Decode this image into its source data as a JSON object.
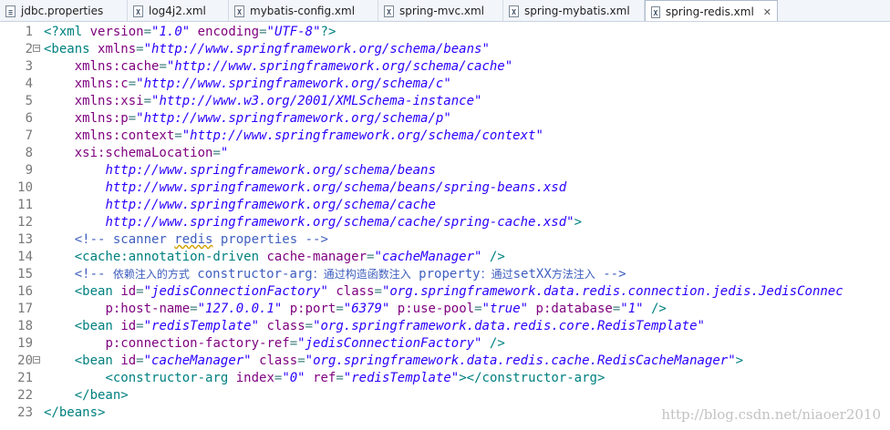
{
  "tabs": [
    {
      "label": "jdbc.properties",
      "icon": "properties-file-icon",
      "active": false
    },
    {
      "label": "log4j2.xml",
      "icon": "xml-file-icon",
      "active": false
    },
    {
      "label": "mybatis-config.xml",
      "icon": "xml-file-icon",
      "active": false
    },
    {
      "label": "spring-mvc.xml",
      "icon": "xml-file-icon",
      "active": false
    },
    {
      "label": "spring-mybatis.xml",
      "icon": "xml-file-icon",
      "active": false
    },
    {
      "label": "spring-redis.xml",
      "icon": "xml-file-icon",
      "active": true,
      "close": "✕"
    }
  ],
  "code_lines": [
    {
      "n": "1",
      "text": "<?xml version=\"1.0\" encoding=\"UTF-8\"?>"
    },
    {
      "n": "2",
      "text": "<beans xmlns=\"http://www.springframework.org/schema/beans\"",
      "fold": true
    },
    {
      "n": "3",
      "text": "    xmlns:cache=\"http://www.springframework.org/schema/cache\""
    },
    {
      "n": "4",
      "text": "    xmlns:c=\"http://www.springframework.org/schema/c\""
    },
    {
      "n": "5",
      "text": "    xmlns:xsi=\"http://www.w3.org/2001/XMLSchema-instance\""
    },
    {
      "n": "6",
      "text": "    xmlns:p=\"http://www.springframework.org/schema/p\""
    },
    {
      "n": "7",
      "text": "    xmlns:context=\"http://www.springframework.org/schema/context\""
    },
    {
      "n": "8",
      "text": "    xsi:schemaLocation=\""
    },
    {
      "n": "9",
      "text": "        http://www.springframework.org/schema/beans"
    },
    {
      "n": "10",
      "text": "        http://www.springframework.org/schema/beans/spring-beans.xsd"
    },
    {
      "n": "11",
      "text": "        http://www.springframework.org/schema/cache"
    },
    {
      "n": "12",
      "text": "        http://www.springframework.org/schema/cache/spring-cache.xsd\">"
    },
    {
      "n": "13",
      "text": "    <!-- scanner redis properties -->"
    },
    {
      "n": "14",
      "text": "    <cache:annotation-driven cache-manager=\"cacheManager\" />"
    },
    {
      "n": "15",
      "text": "    <!-- 依赖注入的方式 constructor-arg：通过构造函数注入 property：通过setXX方法注入 -->"
    },
    {
      "n": "16",
      "text": "    <bean id=\"jedisConnectionFactory\" class=\"org.springframework.data.redis.connection.jedis.JedisConnec"
    },
    {
      "n": "17",
      "text": "        p:host-name=\"127.0.0.1\" p:port=\"6379\" p:use-pool=\"true\" p:database=\"1\" />"
    },
    {
      "n": "18",
      "text": "    <bean id=\"redisTemplate\" class=\"org.springframework.data.redis.core.RedisTemplate\""
    },
    {
      "n": "19",
      "text": "        p:connection-factory-ref=\"jedisConnectionFactory\" />"
    },
    {
      "n": "20",
      "text": "    <bean id=\"cacheManager\" class=\"org.springframework.data.redis.cache.RedisCacheManager\">",
      "fold": true
    },
    {
      "n": "21",
      "text": "        <constructor-arg index=\"0\" ref=\"redisTemplate\"></constructor-arg>"
    },
    {
      "n": "22",
      "text": "    </bean>"
    },
    {
      "n": "23",
      "text": "</beans>"
    }
  ],
  "watermark": "http://blog.csdn.net/niaoer2010",
  "colors": {
    "tag": "#3f7f7f",
    "attribute": "#7f007f",
    "value": "#2a00ff",
    "comment": "#3f5fbf",
    "line_number": "#787878"
  }
}
